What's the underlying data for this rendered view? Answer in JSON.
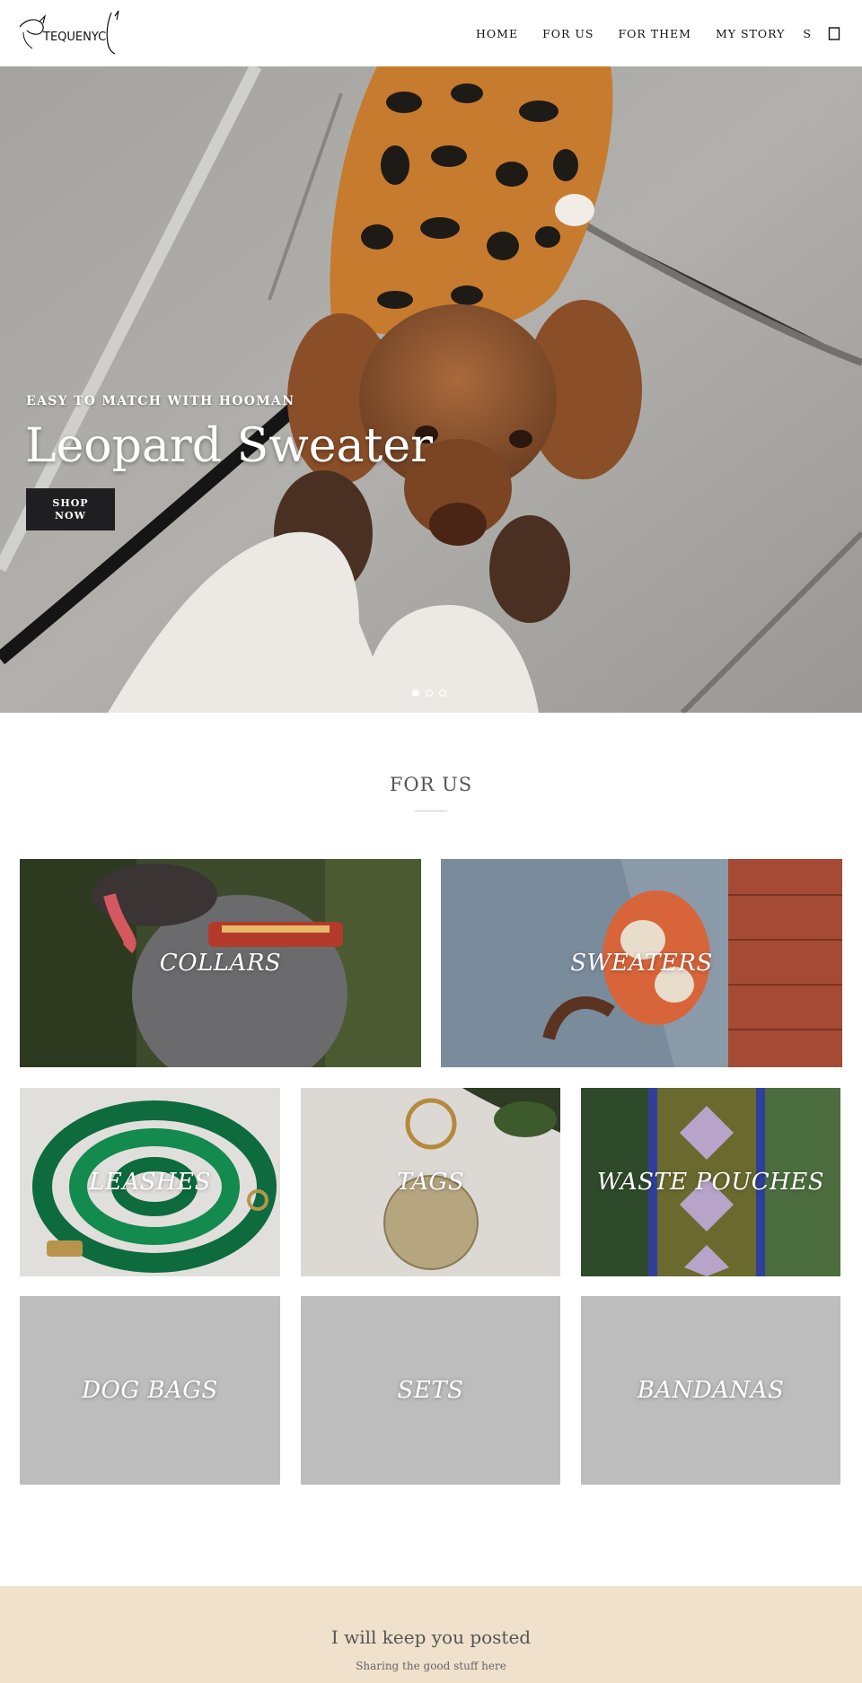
{
  "header": {
    "logo_text": "TEQUENYC",
    "nav": [
      "HOME",
      "FOR US",
      "FOR THEM",
      "MY STORY",
      "S"
    ],
    "cart_icon": "shopping-bag-icon"
  },
  "hero": {
    "eyebrow": "EASY TO MATCH WITH HOOMAN",
    "title": "Leopard Sweater",
    "button": "SHOP NOW",
    "slides": 3,
    "active_slide": 1
  },
  "for_us": {
    "title": "FOR US",
    "categories": [
      {
        "label": "COLLARS"
      },
      {
        "label": "SWEATERS"
      },
      {
        "label": "LEASHES"
      },
      {
        "label": "TAGS"
      },
      {
        "label": "WASTE POUCHES"
      },
      {
        "label": "DOG BAGS"
      },
      {
        "label": "SETS"
      },
      {
        "label": "BANDANAS"
      }
    ]
  },
  "newsletter": {
    "title": "I will keep you posted",
    "subtitle": "Sharing the good stuff here"
  },
  "colors": {
    "button_bg": "#1f1f21",
    "newsletter_bg": "#f0e1cc",
    "placeholder_tile": "#bdbdbd"
  }
}
